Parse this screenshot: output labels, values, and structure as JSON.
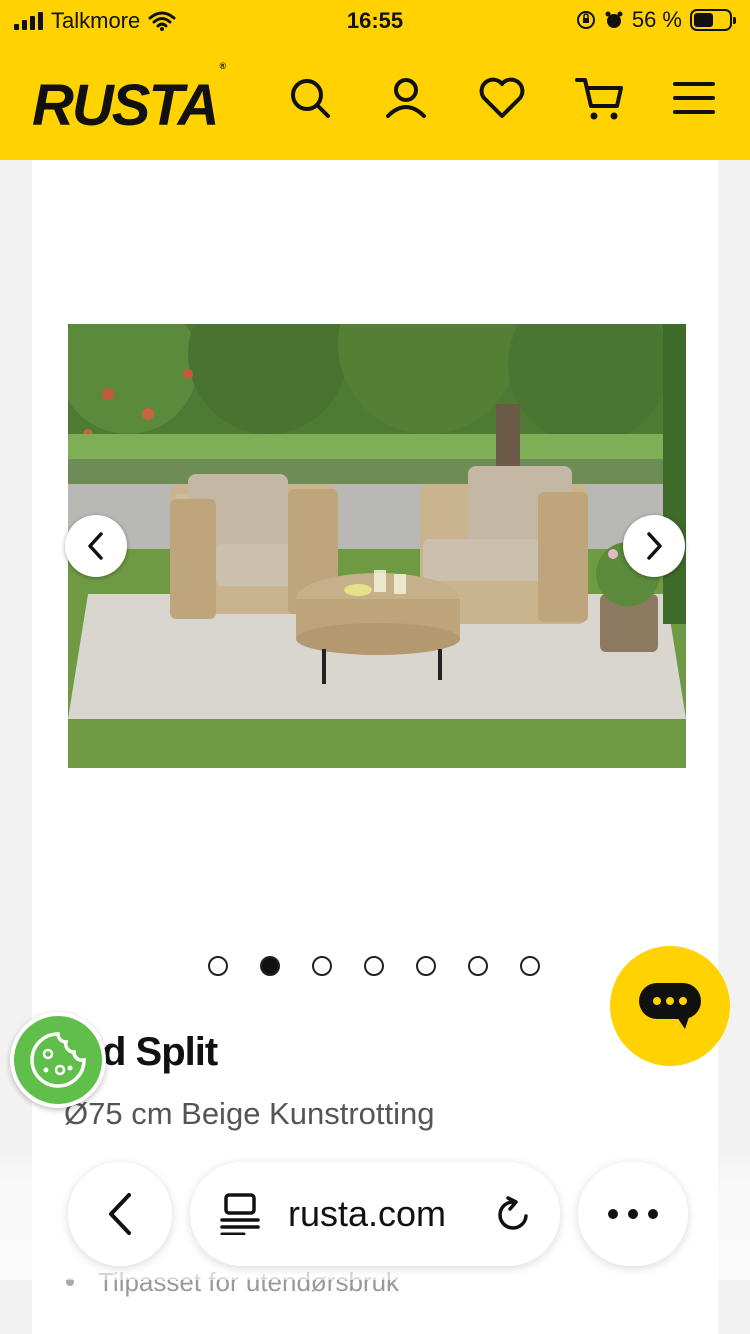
{
  "status_bar": {
    "carrier": "Talkmore",
    "time": "16:55",
    "battery_percent": "56 %",
    "battery_level": 0.56
  },
  "header": {
    "logo": "RUSTA",
    "logo_mark": "®",
    "icons": [
      "search-icon",
      "account-icon",
      "heart-icon",
      "cart-icon",
      "menu-icon"
    ],
    "background": "#ffd200"
  },
  "gallery": {
    "total_images": 7,
    "active_index": 1
  },
  "product": {
    "title": "ord Split",
    "subtitle": "Ø75 cm Beige Kunstrotting",
    "bullets": [
      "Tilpasset for utendørsbruk"
    ]
  },
  "browser": {
    "url": "rusta.com"
  },
  "colors": {
    "brand_yellow": "#ffd200",
    "cookie_green": "#5fbf4a"
  }
}
